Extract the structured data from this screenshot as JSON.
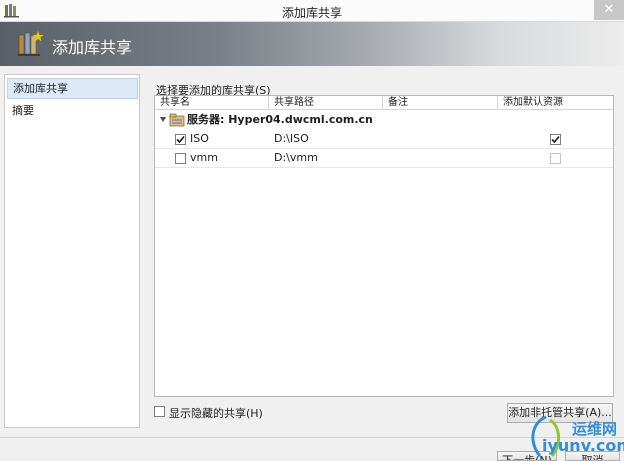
{
  "window": {
    "title": "添加库共享",
    "close": "✕"
  },
  "header": {
    "title": "添加库共享"
  },
  "nav": {
    "items": [
      {
        "label": "添加库共享",
        "selected": true
      },
      {
        "label": "摘要",
        "selected": false
      }
    ]
  },
  "main": {
    "section_label": "选择要添加的库共享(S)",
    "columns": [
      "共享名",
      "共享路径",
      "备注",
      "添加默认资源"
    ],
    "server_label": "服务器: Hyper04.dwcml.com.cn",
    "rows": [
      {
        "name": "ISO",
        "path": "D:\\ISO",
        "note": "",
        "selected": true,
        "add_default": true,
        "add_default_enabled": true
      },
      {
        "name": "vmm",
        "path": "D:\\vmm",
        "note": "",
        "selected": false,
        "add_default": false,
        "add_default_enabled": false
      }
    ]
  },
  "footer": {
    "show_hidden_label": "显示隐藏的共享(H)",
    "show_hidden_checked": false,
    "add_unmanaged_label": "添加非托管共享(A)...",
    "next_label": "下一步(N)",
    "cancel_label": "取消"
  },
  "watermark": {
    "text_top": "运维网",
    "text_bottom": "iyunv.com"
  },
  "colors": {
    "selection": "#dceaf8",
    "accent": "#2f8fd8"
  }
}
